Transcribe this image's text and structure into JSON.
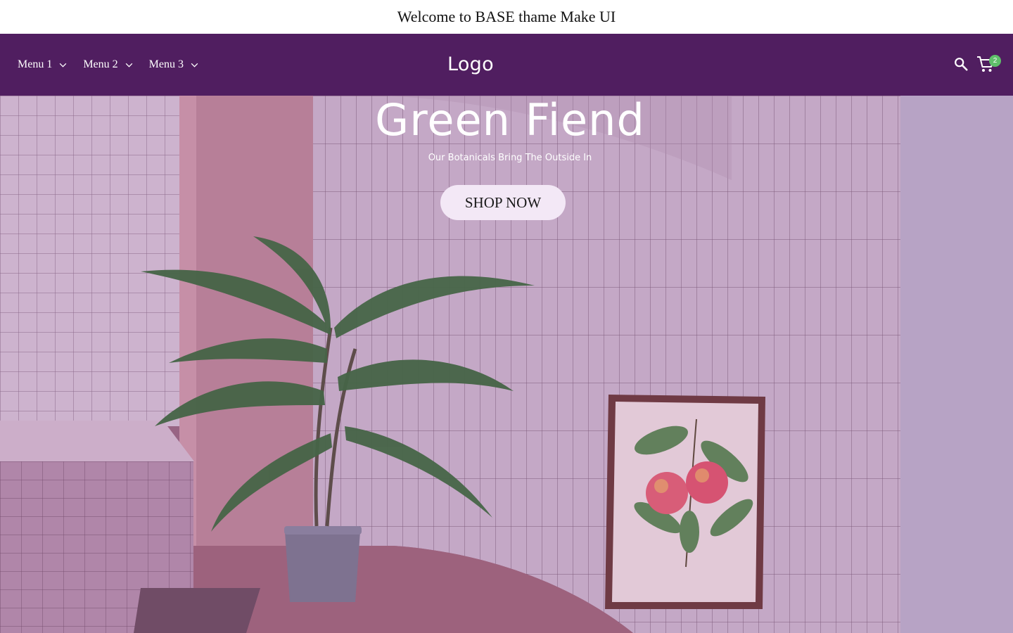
{
  "announcement": {
    "text": "Welcome to BASE thame Make UI"
  },
  "header": {
    "menu": [
      {
        "label": "Menu 1",
        "icon": "chevron-down-icon"
      },
      {
        "label": "Menu 2",
        "icon": "chevron-down-icon"
      },
      {
        "label": "Menu 3",
        "icon": "chevron-down-icon"
      }
    ],
    "logo": "Logo",
    "search_icon": "search-icon",
    "cart_icon": "cart-icon",
    "cart_count": "2"
  },
  "hero": {
    "title": "Green Fiend",
    "subtitle": "Our Botanicals Bring The Outside In",
    "button_label": "SHOP NOW",
    "image": "room-with-palm-plant-and-peach-print"
  },
  "colors": {
    "header_bg": "#501e60",
    "side_panel": "#b7a3c5",
    "button_bg": "#f3e8f6",
    "badge": "#5fbf6a"
  }
}
